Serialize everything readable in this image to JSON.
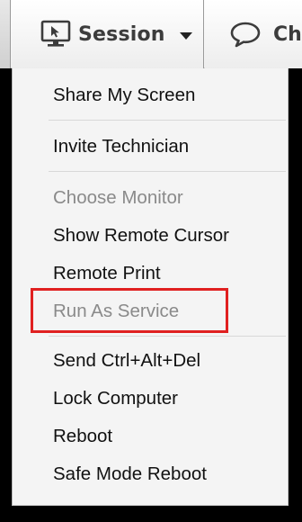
{
  "toolbar": {
    "session_label": "Session",
    "chat_label": "Ch",
    "session_icon": "monitor-cursor-icon",
    "session_caret_icon": "caret-down-icon",
    "chat_icon": "chat-bubble-icon"
  },
  "menu": {
    "items": [
      {
        "label": "Share My Screen",
        "enabled": true
      },
      {
        "label": "Invite Technician",
        "enabled": true
      },
      {
        "label": "Choose Monitor",
        "enabled": false
      },
      {
        "label": "Show Remote Cursor",
        "enabled": true
      },
      {
        "label": "Remote Print",
        "enabled": true
      },
      {
        "label": "Run As Service",
        "enabled": false
      },
      {
        "label": "Send Ctrl+Alt+Del",
        "enabled": true
      },
      {
        "label": "Lock Computer",
        "enabled": true
      },
      {
        "label": "Reboot",
        "enabled": true
      },
      {
        "label": "Safe Mode Reboot",
        "enabled": true
      }
    ]
  },
  "colors": {
    "highlight": "#e02020",
    "disabled_text": "#8a8a8a",
    "menu_background": "#f4f4f4"
  }
}
